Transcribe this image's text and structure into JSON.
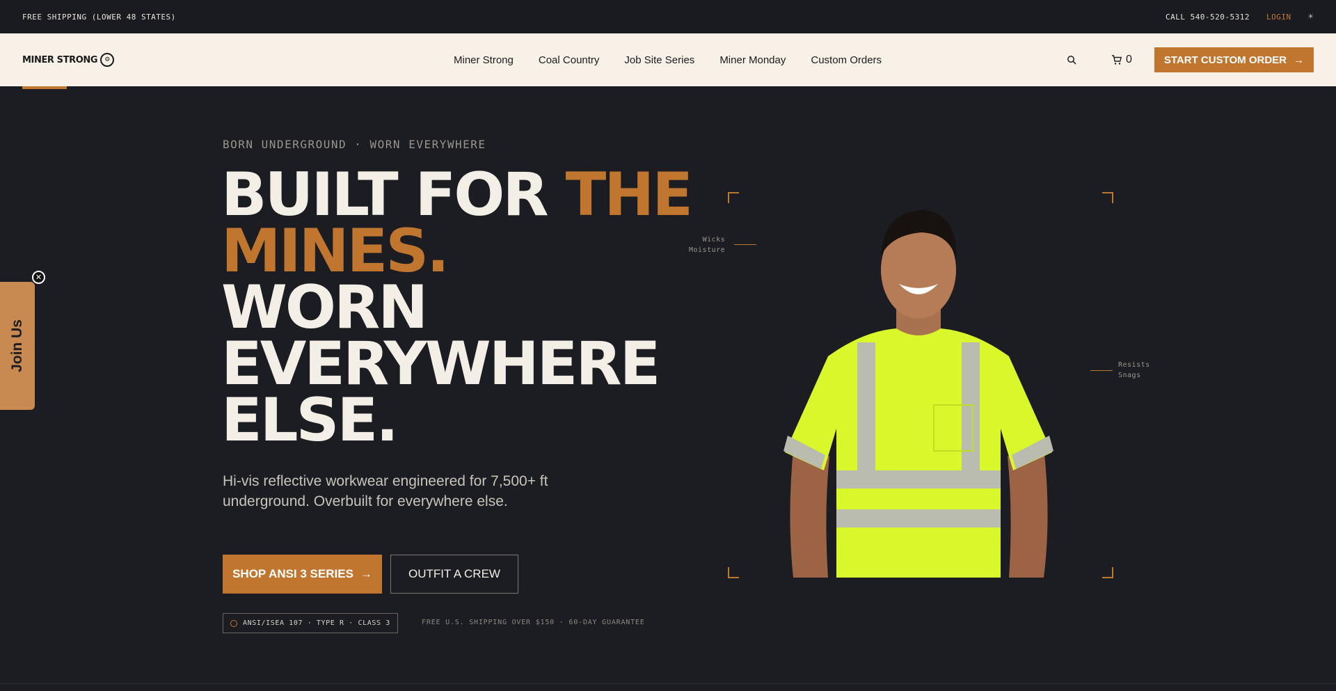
{
  "topbar": {
    "shipping": "FREE SHIPPING (LOWER 48 STATES)",
    "phone": "CALL 540-520-5312",
    "login": "LOGIN"
  },
  "nav": {
    "logo": "MINER STRONG",
    "links": [
      "Miner Strong",
      "Coal Country",
      "Job Site Series",
      "Miner Monday",
      "Custom Orders"
    ],
    "cart_count": "0",
    "cta": "START CUSTOM ORDER",
    "cta_arrow": "→"
  },
  "hero": {
    "eyebrow": "BORN UNDERGROUND · WORN EVERYWHERE",
    "headline_1": "BUILT FOR ",
    "headline_accent": "THE MINES.",
    "headline_2": "WORN EVERYWHERE ELSE.",
    "subtext": "Hi-vis reflective workwear engineered for 7,500+ ft underground. Overbuilt for everywhere else.",
    "primary_button": "SHOP ANSI 3 SERIES",
    "primary_arrow": "→",
    "secondary_button": "OUTFIT A CREW",
    "cert": "ANSI/ISEA 107 · TYPE R · CLASS 3",
    "shipping_note": "FREE U.S. SHIPPING OVER $150 · 60-DAY GUARANTEE"
  },
  "product": {
    "callout_left_1": "Wicks",
    "callout_left_2": "Moisture",
    "callout_right_1": "Resists",
    "callout_right_2": "Snags"
  },
  "popup": {
    "join_label": "Join Us"
  },
  "colors": {
    "accent": "#c0762f",
    "background": "#1c1d22",
    "nav_bg": "#f7f1e8",
    "hivis": "#d9f72a"
  }
}
